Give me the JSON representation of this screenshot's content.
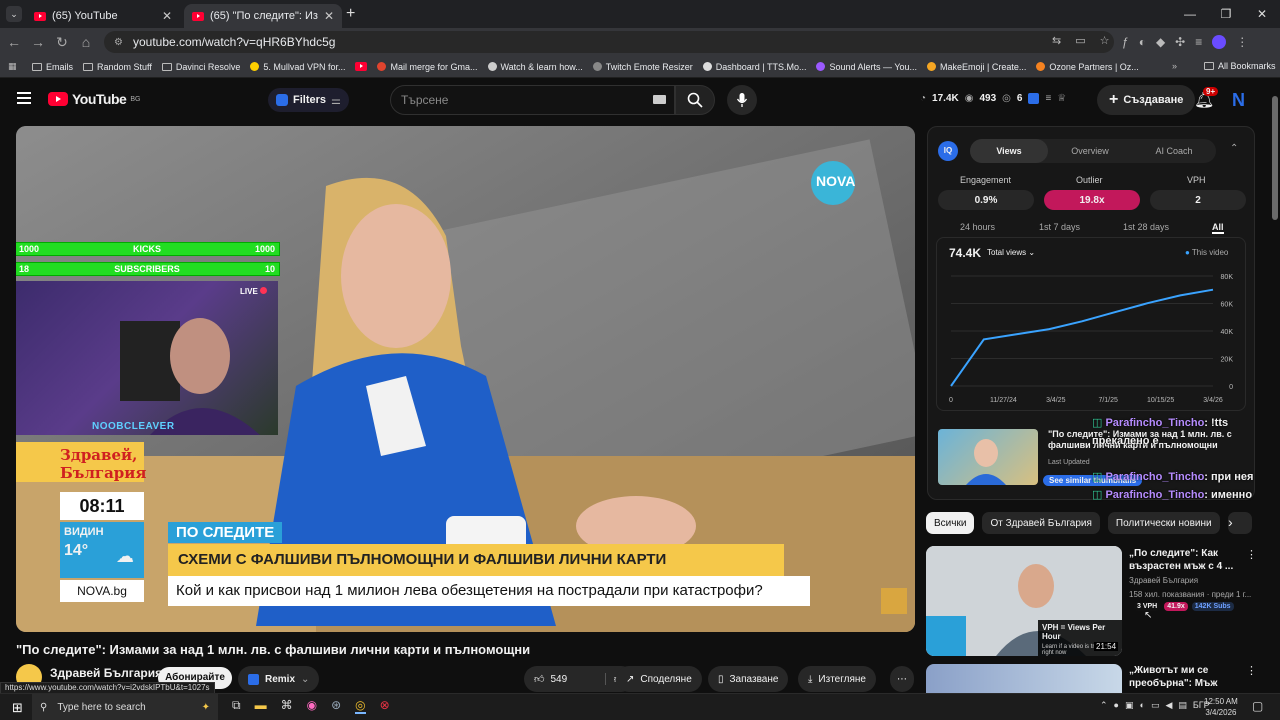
{
  "browser": {
    "tabs": [
      {
        "title": "(65) YouTube",
        "active": false
      },
      {
        "title": "(65) \"По следите\": Измами за",
        "active": true
      }
    ],
    "url": "youtube.com/watch?v=qHR6BYhdc5g",
    "bookmarks": [
      "Emails",
      "Random Stuff",
      "Davinci Resolve",
      "5. Mullvad VPN for...",
      "",
      "Mail merge for Gma...",
      "Watch & learn how...",
      "Twitch Emote Resizer",
      "Dashboard | TTS.Mo...",
      "Sound Alerts — You...",
      "MakeEmoji | Create...",
      "Ozone Partners | Oz..."
    ],
    "all_bookmarks": "All Bookmarks",
    "status_url": "https://www.youtube.com/watch?v=i2vdskIPTbU&t=1027s"
  },
  "header": {
    "logo": "YouTube",
    "country": "BG",
    "filters": "Filters",
    "search_placeholder": "Търсене",
    "stats": {
      "views": "17.4K",
      "subs": "493",
      "videos": "6"
    },
    "create": "Създаване",
    "notif": "9+",
    "avatar": "N"
  },
  "overlay": {
    "kicks_left": "1000",
    "kicks_label": "KICKS",
    "kicks_right": "1000",
    "subs_left": "18",
    "subs_label": "SUBSCRIBERS",
    "subs_right": "10",
    "live": "LIVE",
    "streamer": "NOOBCLEAVER"
  },
  "video": {
    "channel_logo": "NOVA",
    "show_title": "Здравей, България",
    "time": "08:11",
    "city": "ВИДИН",
    "temp": "14°",
    "site": "NOVA.bg",
    "tag": "ПО СЛЕДИТЕ",
    "headline": "СХЕМИ С ФАЛШИВИ ПЪЛНОМОЩНИ И ФАЛШИВИ ЛИЧНИ КАРТИ",
    "subline": "Кой и как присвои над 1 милион лева обезщетения на пострадали при катастрофи?",
    "title": "\"По следите\": Измами за над 1 млн. лв. с фалшиви лични карти и пълномощни",
    "channel": "Здравей България",
    "subscribe": "Абонирайте",
    "remix": "Remix",
    "likes": "549",
    "share": "Споделяне",
    "save": "Запазване",
    "download": "Изтегляне"
  },
  "iq": {
    "tabs": [
      "Views",
      "Overview",
      "AI Coach"
    ],
    "metrics": [
      {
        "label": "Engagement",
        "value": "0.9%"
      },
      {
        "label": "Outlier",
        "value": "19.8x"
      },
      {
        "label": "VPH",
        "value": "2"
      }
    ],
    "ranges": [
      "24 hours",
      "1st 7 days",
      "1st 28 days",
      "All"
    ],
    "total": "74.4K",
    "dropdown": "Total views",
    "legend": "This video",
    "similar_title": "\"По следите\": Измами за над 1 млн. лв. с фалшиви лични карти и пълномощни",
    "last_updated": "Last Updated",
    "see_similar": "See similar thumbnails"
  },
  "chart_data": {
    "type": "line",
    "x": [
      "0",
      "11/27/24",
      "3/4/25",
      "7/1/25",
      "10/15/25",
      "3/4/26"
    ],
    "y_ticks": [
      "80K",
      "60K",
      "40K",
      "20K",
      "0"
    ],
    "ylim": [
      0,
      85000
    ],
    "series": [
      {
        "name": "This video",
        "values": [
          0,
          36000,
          40000,
          44000,
          50000,
          57000,
          64000,
          70000,
          74400
        ]
      }
    ]
  },
  "chat": [
    {
      "user": "Parafincho_Tincho",
      "msg": ": !tts прекалено е"
    },
    {
      "user": "Parafincho_Tincho",
      "msg": ": при нея"
    },
    {
      "user": "Parafincho_Tincho",
      "msg": ": именно"
    }
  ],
  "chips": [
    "Всички",
    "От Здравей България",
    "Политически новини"
  ],
  "recs": [
    {
      "title": "„По следите\": Как възрастен мъж с 4 ...",
      "channel": "Здравей България",
      "meta": "158 хил. показвания · преди 1 г...",
      "vph": "3 VPH",
      "outlier": "41.9x",
      "subs": "142K Subs",
      "duration": "21:54",
      "tip_title": "VPH = Views Per Hour",
      "tip_body": "Learn if a video is trending right now"
    },
    {
      "title": "„Животът ми се преобърна\": Мъж стан...",
      "channel": "",
      "meta": ""
    }
  ],
  "taskbar": {
    "search": "Type here to search",
    "lang": "БГР",
    "time": "12:50 AM",
    "date": "3/4/2026"
  }
}
